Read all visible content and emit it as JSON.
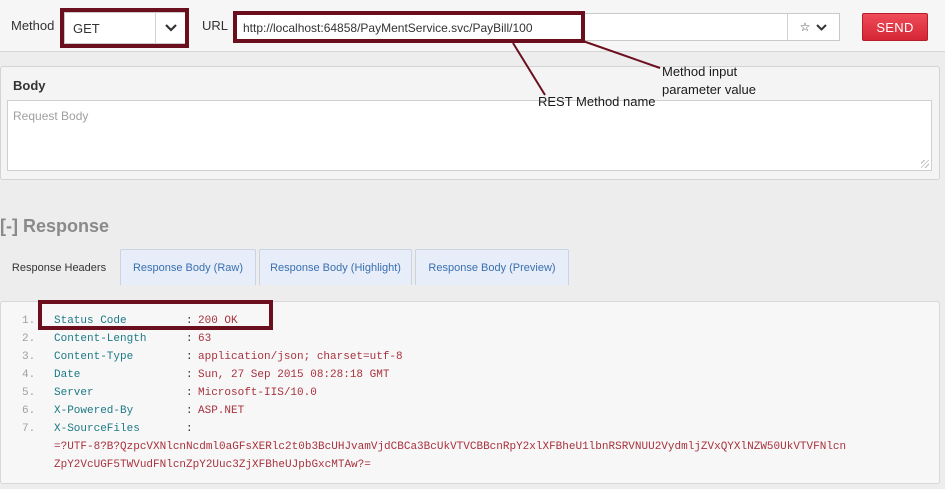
{
  "request": {
    "method_label": "Method",
    "method_value": "GET",
    "url_label": "URL",
    "url_value": "http://localhost:64858/PayMentService.svc/PayBill/100",
    "star_glyph": "☆",
    "chevron_glyph": "⌄",
    "send_label": "SEND"
  },
  "annotations": {
    "input_param": [
      "Method input",
      "parameter value"
    ],
    "method_name": "REST Method name",
    "color": "#6b0f1e"
  },
  "body": {
    "title": "Body",
    "placeholder": "Request Body"
  },
  "response": {
    "title": "[-] Response",
    "tabs": [
      "Response Headers",
      "Response Body (Raw)",
      "Response Body (Highlight)",
      "Response Body (Preview)"
    ],
    "active_tab": "Response Headers",
    "headers": [
      {
        "n": "1.",
        "key": "Status Code",
        "value": "200 OK"
      },
      {
        "n": "2.",
        "key": "Content-Length",
        "value": "63"
      },
      {
        "n": "3.",
        "key": "Content-Type",
        "value": "application/json; charset=utf-8"
      },
      {
        "n": "4.",
        "key": "Date",
        "value": "Sun, 27 Sep 2015 08:28:18 GMT"
      },
      {
        "n": "5.",
        "key": "Server",
        "value": "Microsoft-IIS/10.0"
      },
      {
        "n": "6.",
        "key": "X-Powered-By",
        "value": "ASP.NET"
      },
      {
        "n": "7.",
        "key": "X-SourceFiles",
        "value": ""
      }
    ],
    "sourcefiles_lines": [
      "=?UTF-8?B?QzpcVXNlcnNcdml0aGFsXERlc2t0b3BcUHJvamVjdCBCa3BcUkVTVCBBcnRpY2xlXFBheU1lbnRSRVNUU2VydmljZVxQYXlNZW50UkVTVFNlcn",
      "ZpY2VcUGF5TWVudFNlcnZpY2Uuc3ZjXFBheUJpbGxcMTAw?="
    ],
    "separator": ":"
  }
}
